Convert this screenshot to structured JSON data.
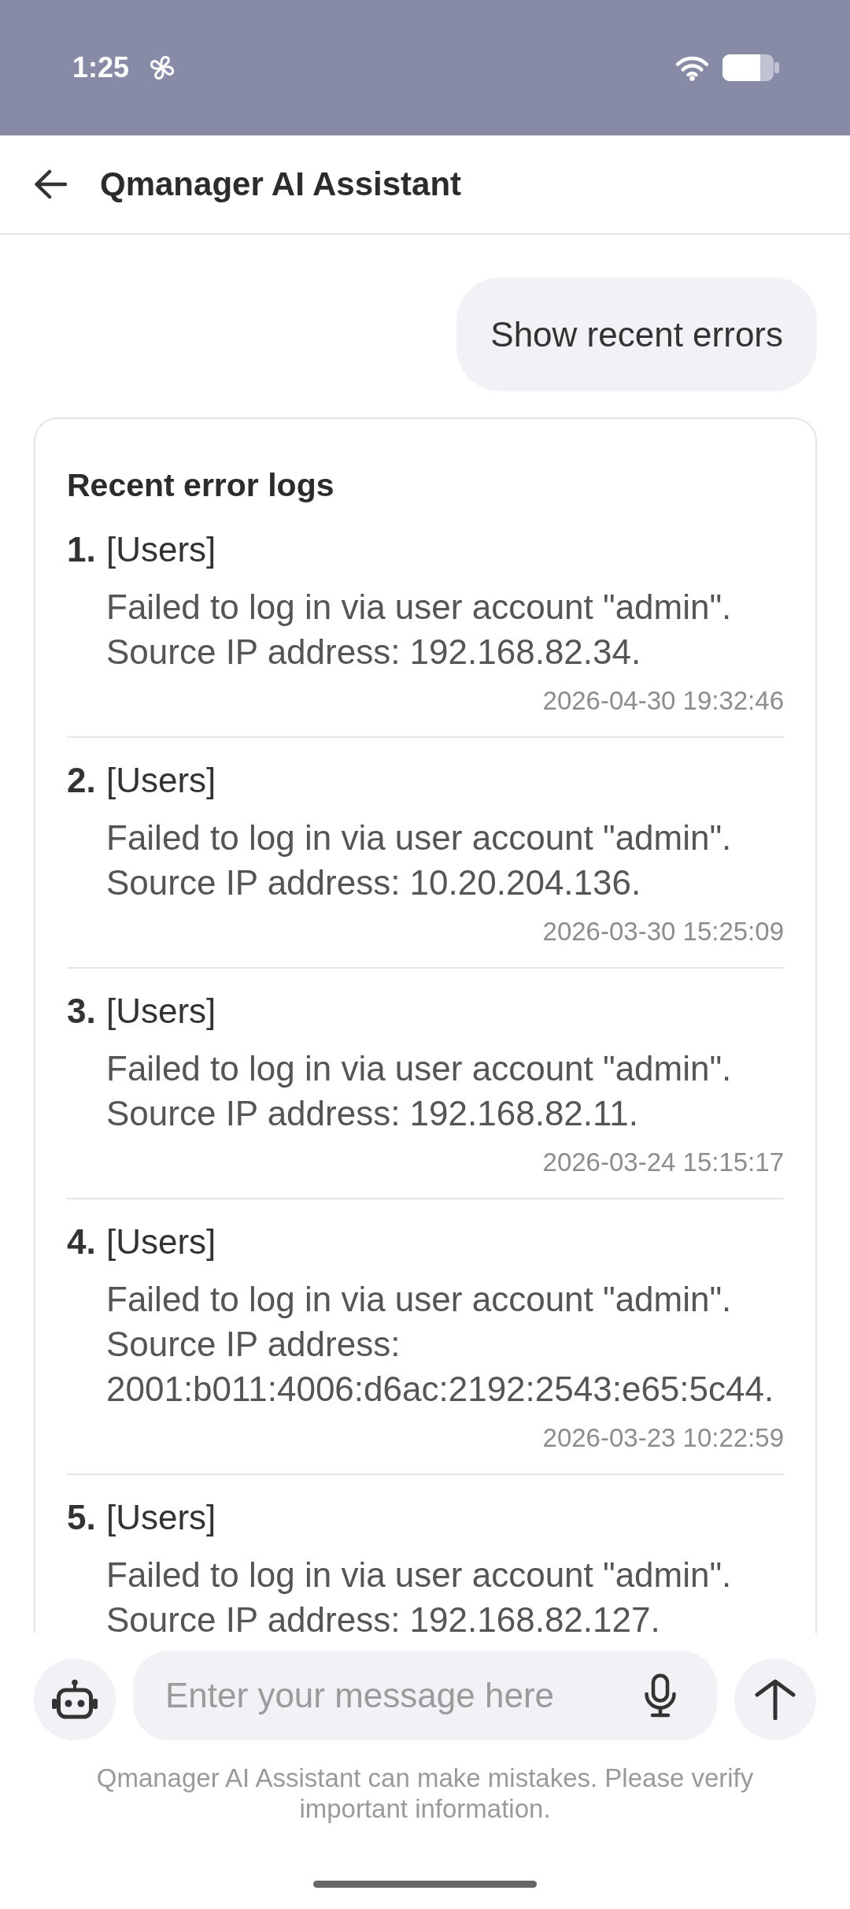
{
  "status_bar": {
    "time": "1:25"
  },
  "header": {
    "title": "Qmanager AI Assistant"
  },
  "messages": [
    {
      "kind": "user",
      "text": "Show recent errors"
    },
    {
      "kind": "assistant",
      "title": "Recent error logs",
      "items": [
        {
          "number": "1.",
          "category": "[Users]",
          "text": "Failed to log in via user account \"admin\". Source IP address: 192.168.82.34.",
          "timestamp": "2026-04-30 19:32:46"
        },
        {
          "number": "2.",
          "category": "[Users]",
          "text": "Failed to log in via user account \"admin\". Source IP address: 10.20.204.136.",
          "timestamp": "2026-03-30 15:25:09"
        },
        {
          "number": "3.",
          "category": "[Users]",
          "text": "Failed to log in via user account \"admin\". Source IP address: 192.168.82.11.",
          "timestamp": "2026-03-24 15:15:17"
        },
        {
          "number": "4.",
          "category": "[Users]",
          "text": "Failed to log in via user account \"admin\". Source IP address: 2001:b011:4006:d6ac:2192:2543:e65:5c44.",
          "timestamp": "2026-03-23 10:22:59"
        },
        {
          "number": "5.",
          "category": "[Users]",
          "text": "Failed to log in via user account \"admin\". Source IP address: 192.168.82.127."
        }
      ]
    }
  ],
  "composer": {
    "placeholder": "Enter your message here"
  },
  "disclaimer": "Qmanager AI Assistant can make mistakes. Please verify important information."
}
